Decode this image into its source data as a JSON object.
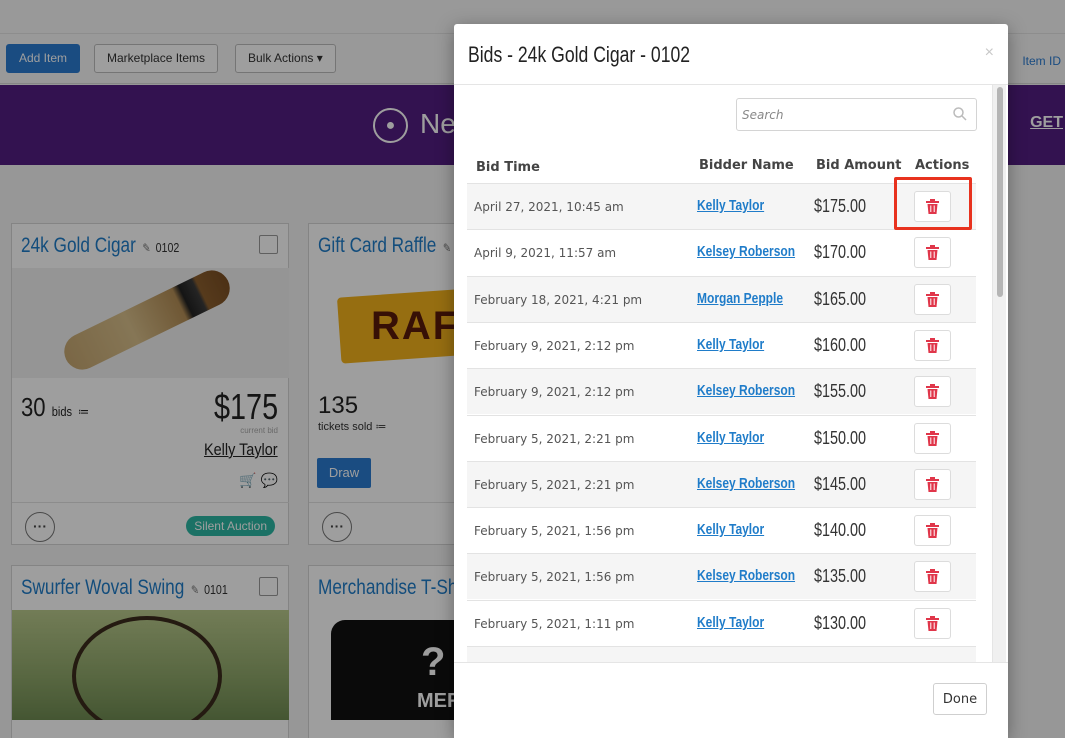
{
  "toolbar": {
    "add_item": "Add Item",
    "marketplace_items": "Marketplace Items",
    "bulk_actions": "Bulk Actions",
    "item_id": "Item ID"
  },
  "banner": {
    "text": "Nee",
    "link": "GET"
  },
  "cards": [
    {
      "title": "24k Gold Cigar",
      "number": "0102",
      "bids": "30",
      "bids_label": "bids",
      "price": "$175",
      "price_label": "current bid",
      "winner": "Kelly Taylor",
      "status": "Silent Auction"
    },
    {
      "title": "Gift Card Raffle",
      "image_text": "RAFF",
      "tickets": "135",
      "tickets_label": "tickets sold",
      "draw": "Draw"
    },
    {
      "title": "Swurfer Woval Swing",
      "number": "0101"
    },
    {
      "title": "Merchandise T-Shir",
      "image_text_q": "?",
      "image_text": "MER"
    }
  ],
  "modal": {
    "title": "Bids - 24k Gold Cigar - 0102",
    "close": "×",
    "search_placeholder": "Search",
    "columns": {
      "time": "Bid Time",
      "bidder": "Bidder Name",
      "amount": "Bid Amount",
      "actions": "Actions"
    },
    "rows": [
      {
        "time": "April 27, 2021, 10:45 am",
        "bidder": "Kelly Taylor",
        "amount": "$175.00"
      },
      {
        "time": "April 9, 2021, 11:57 am",
        "bidder": "Kelsey Roberson",
        "amount": "$170.00"
      },
      {
        "time": "February 18, 2021, 4:21 pm",
        "bidder": "Morgan Pepple",
        "amount": "$165.00"
      },
      {
        "time": "February 9, 2021, 2:12 pm",
        "bidder": "Kelly Taylor",
        "amount": "$160.00"
      },
      {
        "time": "February 9, 2021, 2:12 pm",
        "bidder": "Kelsey Roberson",
        "amount": "$155.00"
      },
      {
        "time": "February 5, 2021, 2:21 pm",
        "bidder": "Kelly Taylor",
        "amount": "$150.00"
      },
      {
        "time": "February 5, 2021, 2:21 pm",
        "bidder": "Kelsey Roberson",
        "amount": "$145.00"
      },
      {
        "time": "February 5, 2021, 1:56 pm",
        "bidder": "Kelly Taylor",
        "amount": "$140.00"
      },
      {
        "time": "February 5, 2021, 1:56 pm",
        "bidder": "Kelsey Roberson",
        "amount": "$135.00"
      },
      {
        "time": "February 5, 2021, 1:11 pm",
        "bidder": "Kelly Taylor",
        "amount": "$130.00"
      }
    ],
    "done": "Done"
  },
  "colors": {
    "brand_purple": "#531d82",
    "link_blue": "#1f7cc9",
    "primary_button": "#2a7bd1",
    "delete_red": "#e0364a",
    "highlight_red": "#e8321e",
    "status_teal": "#2cb7a4"
  },
  "icons": {
    "search": "search-icon",
    "trash": "trash-icon",
    "close": "close-icon",
    "pencil": "pencil-icon",
    "cart": "cart-icon",
    "comment": "comment-icon",
    "list": "list-icon",
    "bulb": "lightbulb-icon"
  }
}
